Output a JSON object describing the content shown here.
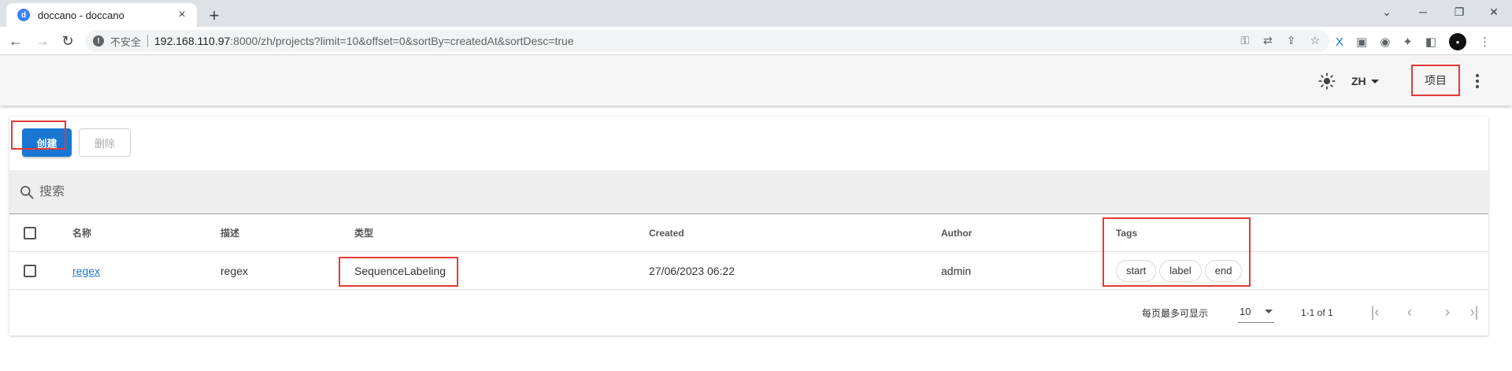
{
  "browser": {
    "tab_title": "doccano - doccano",
    "new_tab_symbol": "+",
    "insecure_label": "不安全",
    "url_host": "192.168.110.97",
    "url_rest": ":8000/zh/projects?limit=10&offset=0&sortBy=createdAt&sortDesc=true"
  },
  "appbar": {
    "lang": "ZH",
    "projects_label": "项目"
  },
  "actions": {
    "create_label": "创建",
    "delete_label": "删除"
  },
  "search": {
    "placeholder": "搜索"
  },
  "table": {
    "headers": {
      "name": "名称",
      "description": "描述",
      "type": "类型",
      "created": "Created",
      "author": "Author",
      "tags": "Tags"
    },
    "rows": [
      {
        "name": "regex",
        "description": "regex",
        "type": "SequenceLabeling",
        "created": "27/06/2023 06:22",
        "author": "admin",
        "tags": [
          "start",
          "label",
          "end"
        ]
      }
    ]
  },
  "footer": {
    "rows_per_page_label": "每页最多可显示",
    "rows_per_page_value": "10",
    "range_text": "1-1 of 1"
  },
  "colors": {
    "primary": "#1976d2",
    "highlight": "#e53935"
  }
}
